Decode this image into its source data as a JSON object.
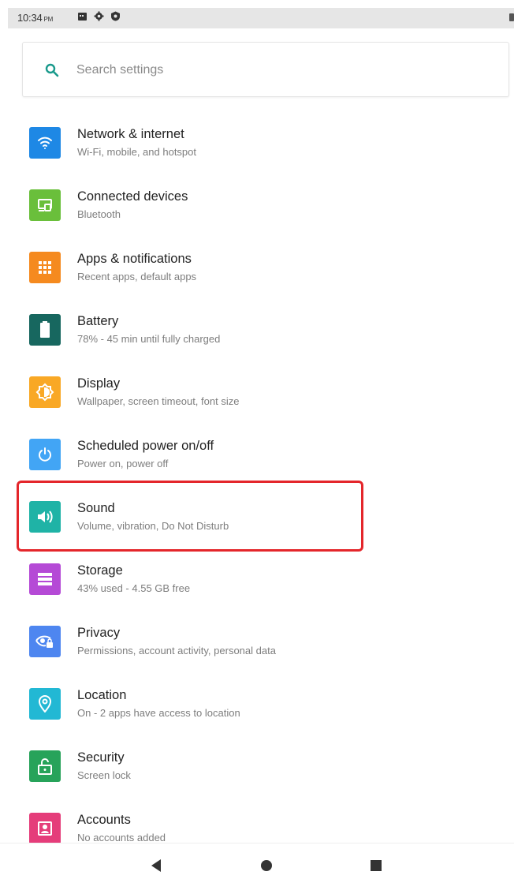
{
  "status_bar": {
    "time": "10:34",
    "ampm": "PM",
    "icons": [
      "calendar-icon",
      "settings-icon",
      "vpn-icon"
    ]
  },
  "search": {
    "placeholder": "Search settings",
    "accent": "#1a9a8c"
  },
  "settings": [
    {
      "title": "Network & internet",
      "subtitle": "Wi-Fi, mobile, and hotspot",
      "icon": "wifi-icon",
      "color": "#1e88e5"
    },
    {
      "title": "Connected devices",
      "subtitle": "Bluetooth",
      "icon": "devices-icon",
      "color": "#6abf3b"
    },
    {
      "title": "Apps & notifications",
      "subtitle": "Recent apps, default apps",
      "icon": "apps-icon",
      "color": "#f58a1f"
    },
    {
      "title": "Battery",
      "subtitle": "78% - 45 min until fully charged",
      "icon": "battery-icon",
      "color": "#17675f"
    },
    {
      "title": "Display",
      "subtitle": "Wallpaper, screen timeout, font size",
      "icon": "display-icon",
      "color": "#f9a825"
    },
    {
      "title": "Scheduled power on/off",
      "subtitle": "Power on, power off",
      "icon": "power-icon",
      "color": "#42a5f5"
    },
    {
      "title": "Sound",
      "subtitle": "Volume, vibration, Do Not Disturb",
      "icon": "volume-icon",
      "color": "#1fb3a6"
    },
    {
      "title": "Storage",
      "subtitle": "43% used - 4.55 GB free",
      "icon": "storage-icon",
      "color": "#b54ad6"
    },
    {
      "title": "Privacy",
      "subtitle": "Permissions, account activity, personal data",
      "icon": "privacy-icon",
      "color": "#4e86f0"
    },
    {
      "title": "Location",
      "subtitle": "On - 2 apps have access to location",
      "icon": "location-icon",
      "color": "#22b8d4"
    },
    {
      "title": "Security",
      "subtitle": "Screen lock",
      "icon": "lock-icon",
      "color": "#27a35a"
    },
    {
      "title": "Accounts",
      "subtitle": "No accounts added",
      "icon": "accounts-icon",
      "color": "#e53d7a"
    }
  ],
  "highlight": {
    "color": "#e4262b",
    "target": "Sound"
  },
  "nav": [
    "back-icon",
    "home-icon",
    "recents-icon"
  ]
}
